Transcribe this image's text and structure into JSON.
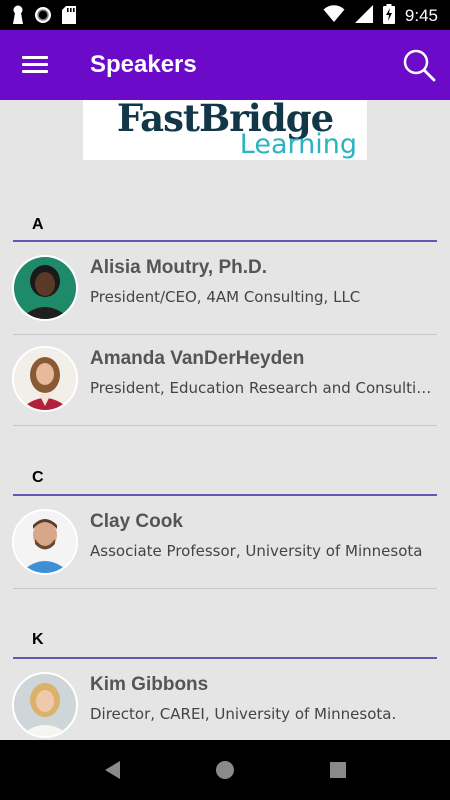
{
  "status_bar": {
    "time": "9:45",
    "left_icons": [
      "keyhole-icon",
      "record-icon",
      "sd-card-icon"
    ],
    "right_icons": [
      "wifi-icon",
      "signal-icon",
      "battery-charging-icon"
    ]
  },
  "app_bar": {
    "title": "Speakers",
    "menu_icon": "menu-icon",
    "search_icon": "search-icon",
    "color": "#6b0ac9"
  },
  "logo": {
    "line1": "FastBridge",
    "line2": "Learning"
  },
  "sections": [
    {
      "letter": "A",
      "speakers": [
        {
          "name": "Alisia Moutry, Ph.D.",
          "title": "President/CEO, 4AM Consulting, LLC"
        },
        {
          "name": "Amanda VanDerHeyden",
          "title": "President, Education Research and Consulting, Inc."
        }
      ]
    },
    {
      "letter": "C",
      "speakers": [
        {
          "name": "Clay Cook",
          "title": "Associate Professor, University of Minnesota"
        }
      ]
    },
    {
      "letter": "K",
      "speakers": [
        {
          "name": "Kim Gibbons",
          "title": "Director, CAREI, University of Minnesota."
        }
      ]
    }
  ],
  "nav_bar": {
    "icons": [
      "back-icon",
      "home-icon",
      "recents-icon"
    ]
  },
  "colors": {
    "accent": "#6b0ac9",
    "section_rule": "#6b53b5",
    "background": "#e5e5e5"
  }
}
